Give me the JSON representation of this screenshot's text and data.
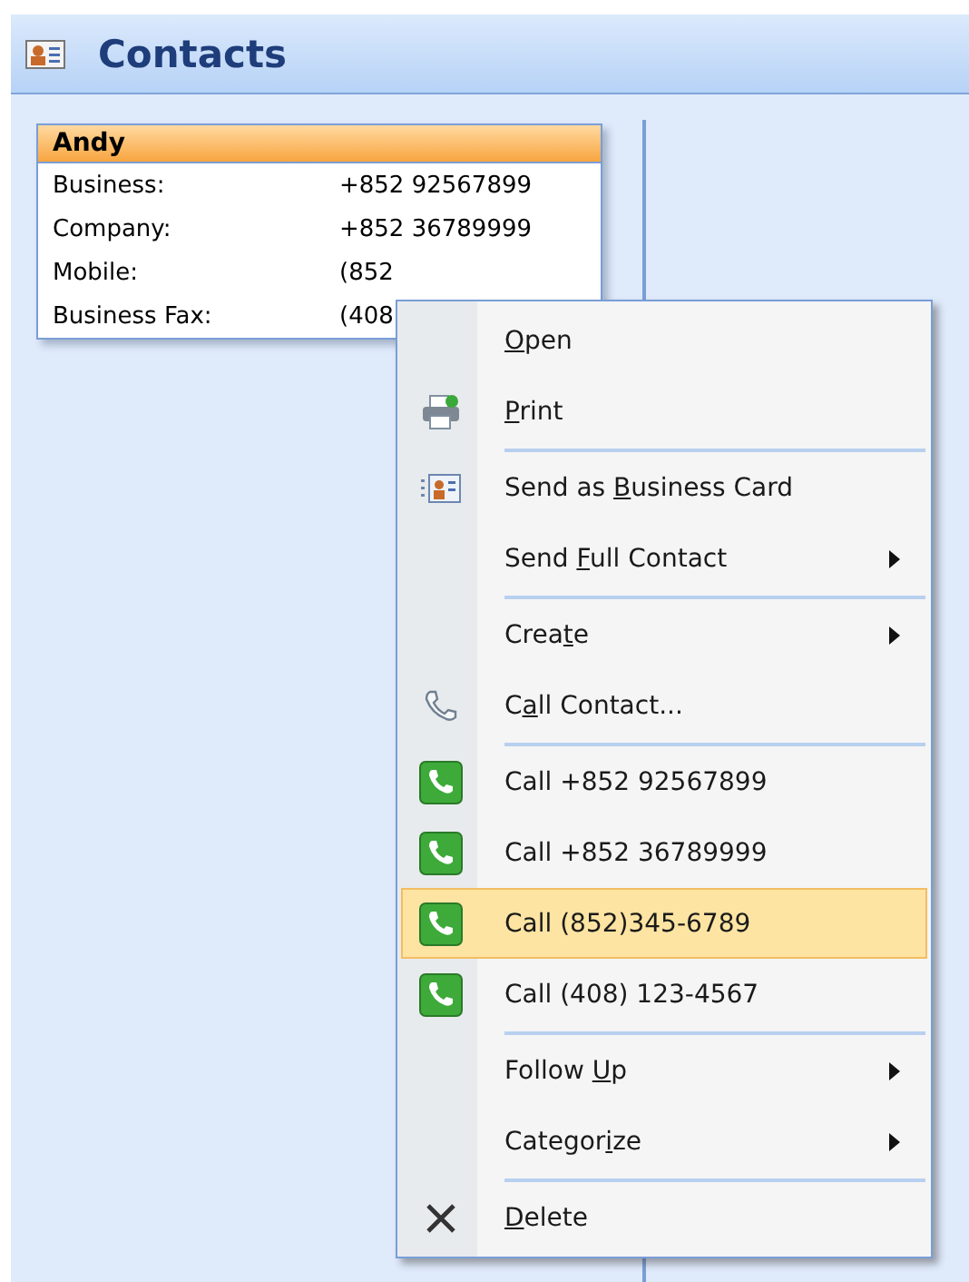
{
  "header": {
    "title": "Contacts"
  },
  "card": {
    "name": "Andy",
    "fields": [
      {
        "label": "Business:",
        "value": "+852 92567899"
      },
      {
        "label": "Company:",
        "value": "+852 36789999"
      },
      {
        "label": "Mobile:",
        "value": "(852"
      },
      {
        "label": "Business Fax:",
        "value": "(408"
      }
    ]
  },
  "context_menu": {
    "items": [
      {
        "kind": "plain",
        "label": {
          "key": "O",
          "after": "pen"
        },
        "submenu": false,
        "separator_before": false,
        "selected": false
      },
      {
        "kind": "print",
        "label": {
          "key": "P",
          "after": "rint"
        },
        "submenu": false,
        "separator_before": false,
        "selected": false
      },
      {
        "kind": "card",
        "label": {
          "before": "Send as ",
          "key": "B",
          "after": "usiness Card"
        },
        "submenu": false,
        "separator_before": true,
        "selected": false
      },
      {
        "kind": "plain",
        "label": {
          "before": "Send ",
          "key": "F",
          "after": "ull Contact"
        },
        "submenu": true,
        "separator_before": false,
        "selected": false
      },
      {
        "kind": "plain",
        "label": {
          "before": "Crea",
          "key": "t",
          "after": "e"
        },
        "submenu": true,
        "separator_before": true,
        "selected": false
      },
      {
        "kind": "handset",
        "label": {
          "before": "C",
          "key": "a",
          "after": "ll Contact..."
        },
        "submenu": false,
        "separator_before": false,
        "selected": false
      },
      {
        "kind": "call",
        "label": {
          "before": "Call +852 92567899"
        },
        "submenu": false,
        "separator_before": true,
        "selected": false
      },
      {
        "kind": "call",
        "label": {
          "before": "Call +852 36789999"
        },
        "submenu": false,
        "separator_before": false,
        "selected": false
      },
      {
        "kind": "call",
        "label": {
          "before": "Call (852)345-6789"
        },
        "submenu": false,
        "separator_before": false,
        "selected": true
      },
      {
        "kind": "call",
        "label": {
          "before": "Call (408) 123-4567"
        },
        "submenu": false,
        "separator_before": false,
        "selected": false
      },
      {
        "kind": "plain",
        "label": {
          "before": "Follow ",
          "key": "U",
          "after": "p"
        },
        "submenu": true,
        "separator_before": true,
        "selected": false
      },
      {
        "kind": "plain",
        "label": {
          "before": "Categor",
          "key": "i",
          "after": "ze"
        },
        "submenu": true,
        "separator_before": false,
        "selected": false
      },
      {
        "kind": "delete",
        "label": {
          "key": "D",
          "after": "elete"
        },
        "submenu": false,
        "separator_before": true,
        "selected": false
      }
    ]
  }
}
